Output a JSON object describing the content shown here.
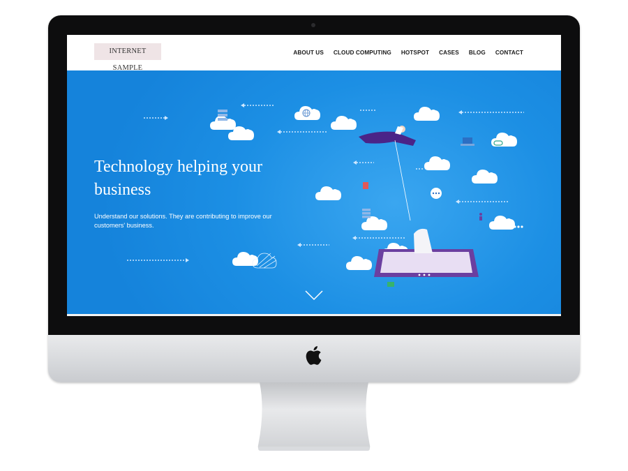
{
  "brand": {
    "name": "INTERNET SAMPLE"
  },
  "nav": {
    "items": [
      {
        "label": "ABOUT US"
      },
      {
        "label": "CLOUD COMPUTING"
      },
      {
        "label": "HOTSPOT"
      },
      {
        "label": "CASES"
      },
      {
        "label": "BLOG"
      },
      {
        "label": "CONTACT"
      }
    ]
  },
  "hero": {
    "title": "Technology helping your business",
    "subtitle": "Understand our solutions. They are contributing to improve our customers' business."
  },
  "icons": {
    "device_logo": "apple-logo-icon",
    "scroll": "chevron-down-icon"
  },
  "colors": {
    "hero_blue": "#1f92e6",
    "brand_bg": "#efe4e6",
    "accent_purple": "#5b2c8f"
  }
}
